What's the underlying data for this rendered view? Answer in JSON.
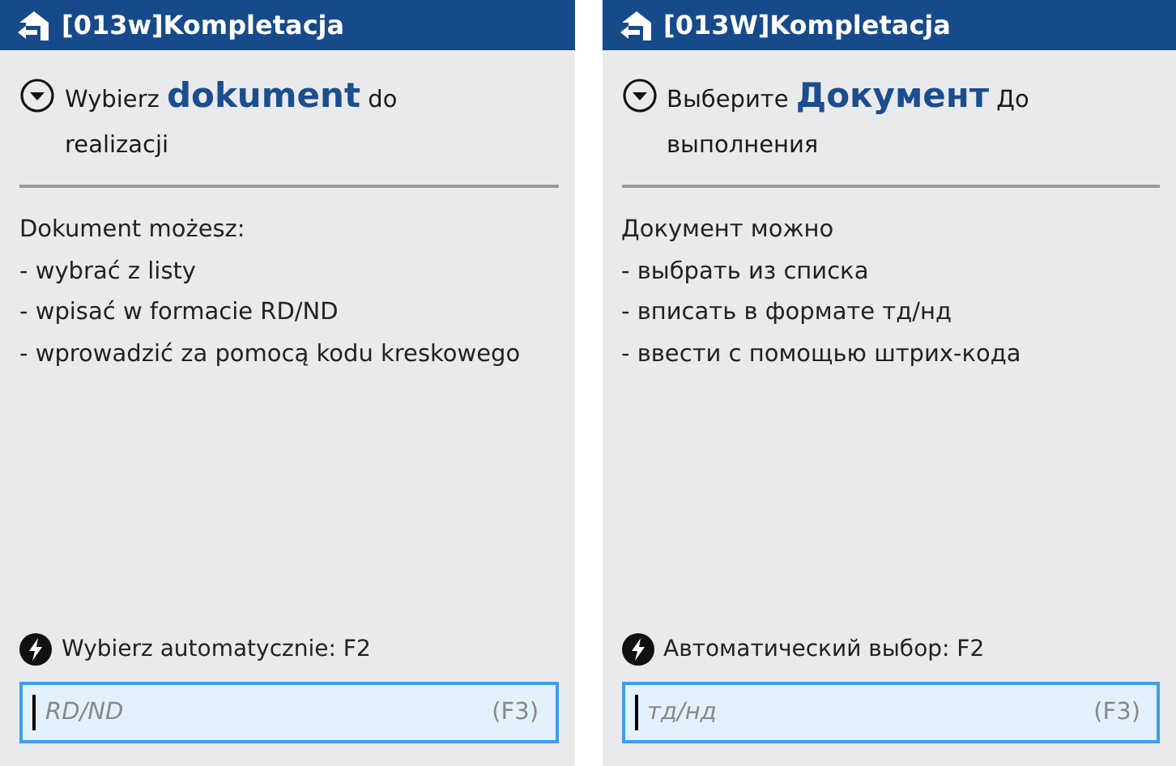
{
  "panels": [
    {
      "title": "[013w]Kompletacja",
      "heading": "Wybierz **dokument** do realizacji",
      "body": [
        "Dokument możesz:",
        "- wybrać z listy",
        "- wpisać w formacie RD/ND",
        "- wprowadzić za pomocą kodu kreskowego"
      ],
      "auto_label": "Wybierz automatycznie: F2",
      "field": {
        "placeholder": "RD/ND",
        "shortcut": "(F3)"
      }
    },
    {
      "title": "[013W]Kompletacja",
      "heading": "Выберите **Документ** До выполнения",
      "body": [
        "Документ можно",
        "- выбрать из списка",
        "- вписать в формате тд/нд",
        "- ввести с помощью штрих-кода"
      ],
      "auto_label": "Автоматический выбор: F2",
      "field": {
        "placeholder": "тд/нд",
        "shortcut": "(F3)"
      }
    }
  ]
}
